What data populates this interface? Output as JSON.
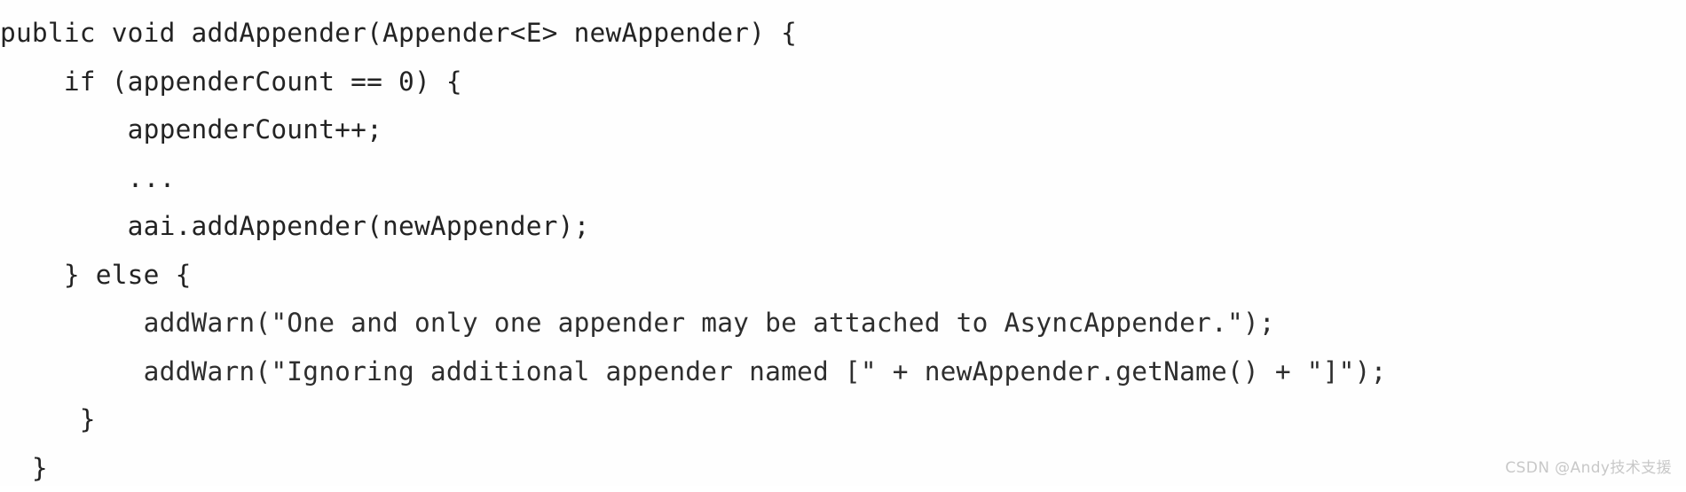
{
  "page": {
    "background_color": "#ffffff",
    "text_color": "#232323",
    "language": "java"
  },
  "code": {
    "lines": [
      {
        "id": "line-1",
        "indent": 0,
        "text": "public void addAppender(Appender<E> newAppender) {"
      },
      {
        "id": "line-2",
        "indent": 1,
        "text": "    if (appenderCount == 0) {"
      },
      {
        "id": "line-3",
        "indent": 2,
        "text": "        appenderCount++;"
      },
      {
        "id": "line-4",
        "indent": 2,
        "text": "        ..."
      },
      {
        "id": "line-5",
        "indent": 2,
        "text": "        aai.addAppender(newAppender);"
      },
      {
        "id": "line-6",
        "indent": 1,
        "text": "    } else {"
      },
      {
        "id": "line-7",
        "indent": 2,
        "text": "         addWarn(\"One and only one appender may be attached to AsyncAppender.\");"
      },
      {
        "id": "line-8",
        "indent": 2,
        "text": "         addWarn(\"Ignoring additional appender named [\" + newAppender.getName() + \"]\");"
      },
      {
        "id": "line-9",
        "indent": 1,
        "text": "     }"
      },
      {
        "id": "line-10",
        "indent": 0,
        "text": "  }"
      }
    ]
  },
  "watermark": {
    "text": "CSDN @Andy技术支援",
    "color": "#c8c8c8"
  }
}
